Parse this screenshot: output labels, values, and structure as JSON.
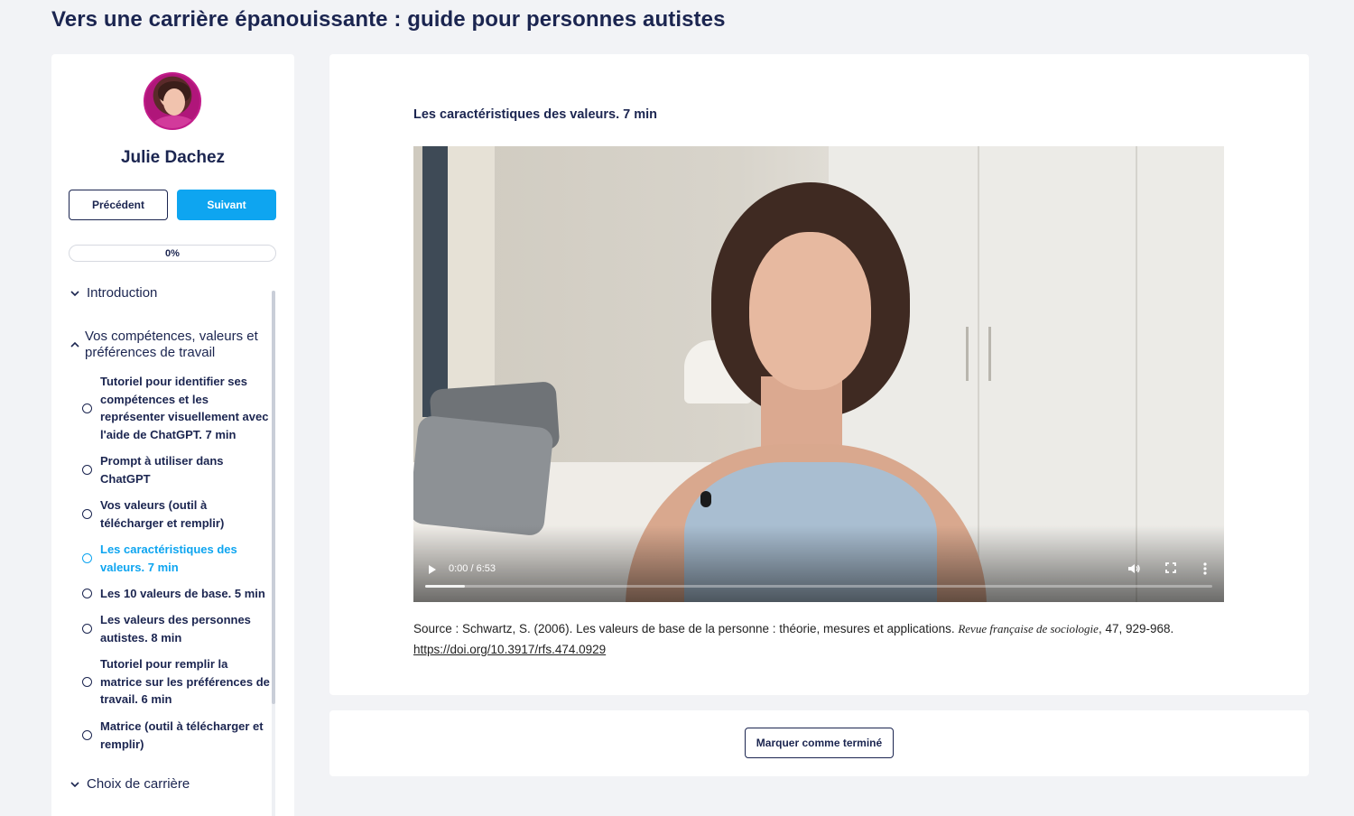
{
  "page": {
    "title": "Vers une carrière épanouissante : guide pour personnes autistes"
  },
  "sidebar": {
    "author_name": "Julie Dachez",
    "prev_label": "Précédent",
    "next_label": "Suivant",
    "progress_label": "0%",
    "progress_percent": 0,
    "sections": [
      {
        "label": "Introduction",
        "expanded": false
      },
      {
        "label": "Vos compétences, valeurs et préférences de travail",
        "expanded": true
      },
      {
        "label": "Choix de carrière",
        "expanded": false
      }
    ],
    "lessons": [
      {
        "label": "Tutoriel pour identifier ses compétences et les représenter visuellement avec l'aide de ChatGPT. 7 min",
        "active": false
      },
      {
        "label": "Prompt à utiliser dans ChatGPT",
        "active": false
      },
      {
        "label": "Vos valeurs (outil à télécharger et remplir)",
        "active": false
      },
      {
        "label": "Les caractéristiques des valeurs. 7 min",
        "active": true
      },
      {
        "label": "Les 10 valeurs de base. 5 min",
        "active": false
      },
      {
        "label": "Les valeurs des personnes autistes. 8 min",
        "active": false
      },
      {
        "label": "Tutoriel pour remplir la matrice sur les préférences de travail. 6 min",
        "active": false
      },
      {
        "label": "Matrice (outil à télécharger et remplir)",
        "active": false
      }
    ]
  },
  "main": {
    "lesson_title": "Les caractéristiques des valeurs. 7 min",
    "video": {
      "time": "0:00 / 6:53",
      "played_fraction": 0.05
    },
    "source": {
      "prefix": "Source : Schwartz, S. (2006). Les valeurs de base de la personne : théorie, mesures et applications.",
      "journal": "Revue française de sociologie",
      "suffix": ", 47, 929-968.",
      "link": "https://doi.org/10.3917/rfs.474.0929"
    }
  },
  "footer": {
    "done_label": "Marquer comme terminé"
  },
  "colors": {
    "primary": "#1b2550",
    "accent": "#0ea5f0",
    "background": "#f2f3f6"
  }
}
